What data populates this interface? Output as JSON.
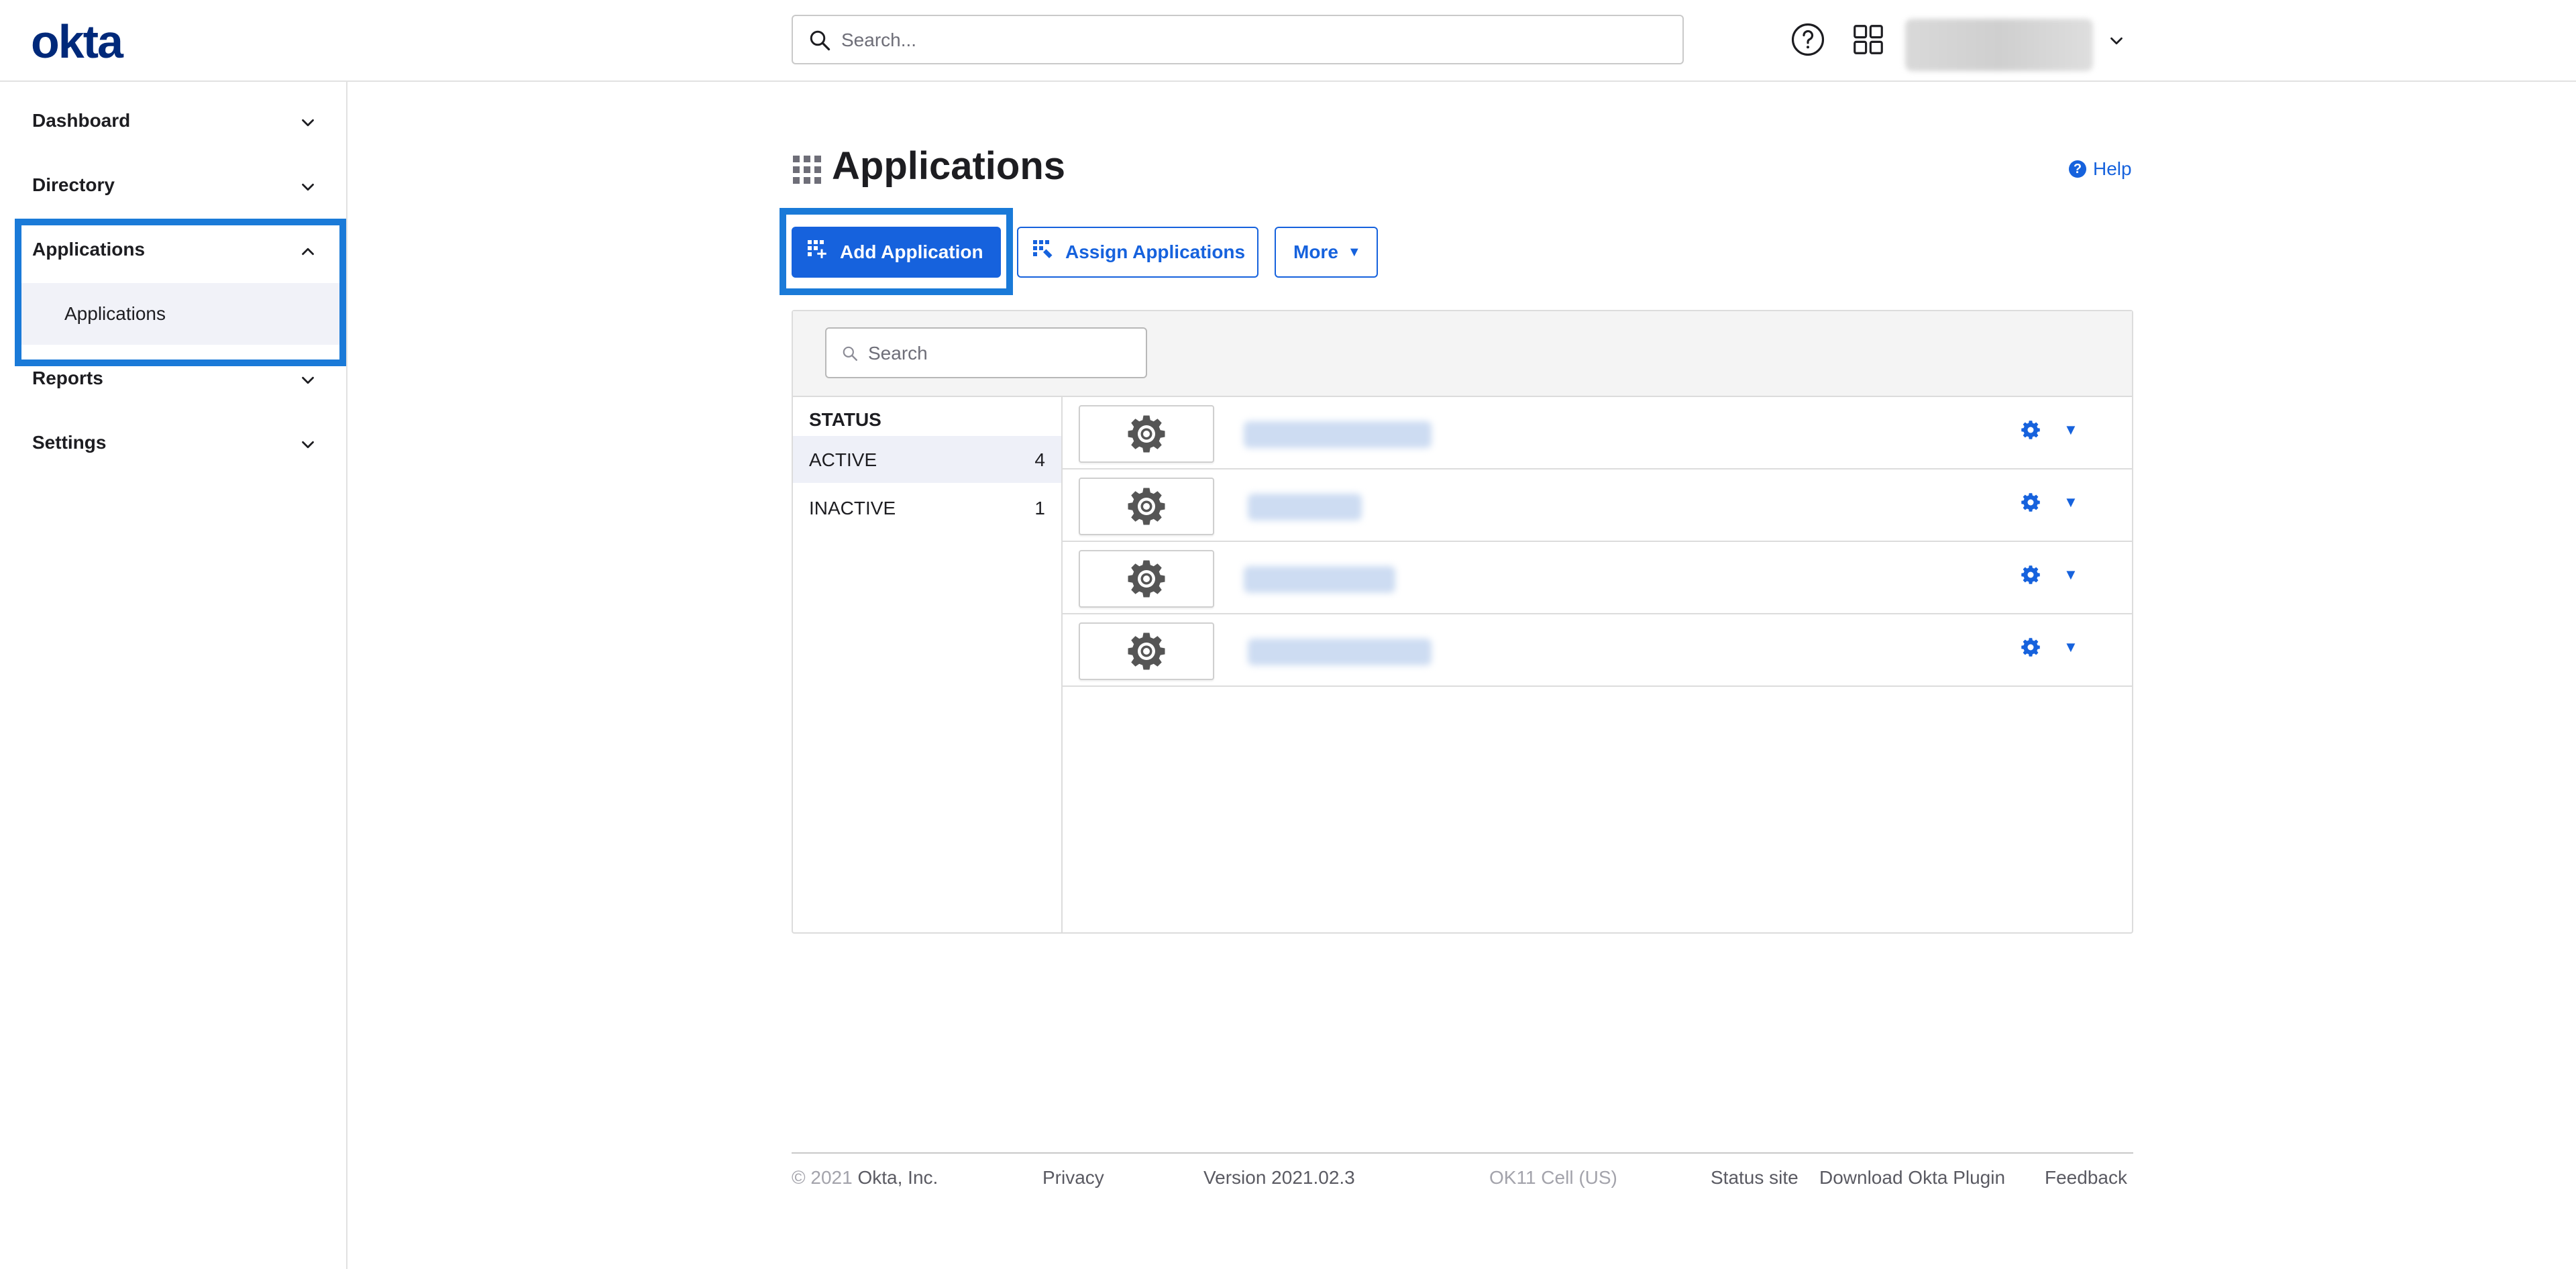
{
  "header": {
    "logo": "okta",
    "search_placeholder": "Search...",
    "help_icon": "question-circle-icon",
    "apps_icon": "app-grid-icon"
  },
  "sidebar": {
    "items": [
      {
        "label": "Dashboard",
        "expanded": false
      },
      {
        "label": "Directory",
        "expanded": false
      },
      {
        "label": "Applications",
        "expanded": true
      },
      {
        "label": "Reports",
        "expanded": false
      },
      {
        "label": "Settings",
        "expanded": false
      }
    ],
    "sub_item": "Applications"
  },
  "main": {
    "title": "Applications",
    "help": "Help",
    "buttons": {
      "add": "Add Application",
      "assign": "Assign Applications",
      "more": "More"
    },
    "panel": {
      "search_placeholder": "Search",
      "status_heading": "STATUS",
      "statuses": [
        {
          "label": "ACTIVE",
          "count": "4"
        },
        {
          "label": "INACTIVE",
          "count": "1"
        }
      ]
    }
  },
  "footer": {
    "copyright_symbol": "© 2021",
    "company": "Okta, Inc.",
    "privacy": "Privacy",
    "version": "Version 2021.02.3",
    "cell": "OK11 Cell (US)",
    "status_site": "Status site",
    "download": "Download Okta Plugin",
    "feedback": "Feedback"
  },
  "colors": {
    "brand": "#00297a",
    "accent": "#1662dd",
    "highlight": "#1a7ad8"
  }
}
